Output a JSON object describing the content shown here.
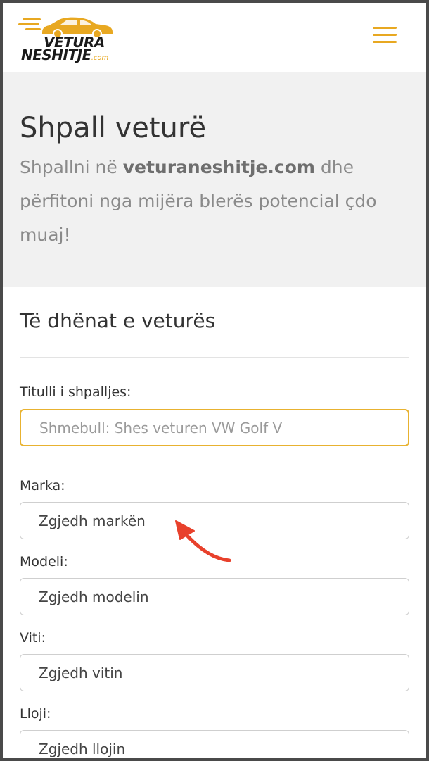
{
  "header": {
    "logo": {
      "line1": "VETURA",
      "line2": "NESHITJE",
      "suffix": ".com"
    },
    "menu_icon": "hamburger-menu-icon"
  },
  "hero": {
    "title": "Shpall veturë",
    "subtitle_pre": "Shpallni në ",
    "subtitle_site": "veturaneshitje.com",
    "subtitle_post": " dhe përfitoni nga mijëra blerës potencial çdo muaj!"
  },
  "form": {
    "section_title": "Të dhënat e veturës",
    "title_label": "Titulli i shpalljes:",
    "title_placeholder": "Shmebull: Shes veturen VW Golf V",
    "brand_label": "Marka:",
    "brand_value": "Zgjedh markën",
    "model_label": "Modeli:",
    "model_value": "Zgjedh modelin",
    "year_label": "Viti:",
    "year_value": "Zgjedh vitin",
    "type_label": "Lloji:",
    "type_value": "Zgjedh llojin"
  },
  "colors": {
    "accent": "#e8a821",
    "annotation_arrow": "#e8412c",
    "hero_bg": "#f1f1f1"
  }
}
